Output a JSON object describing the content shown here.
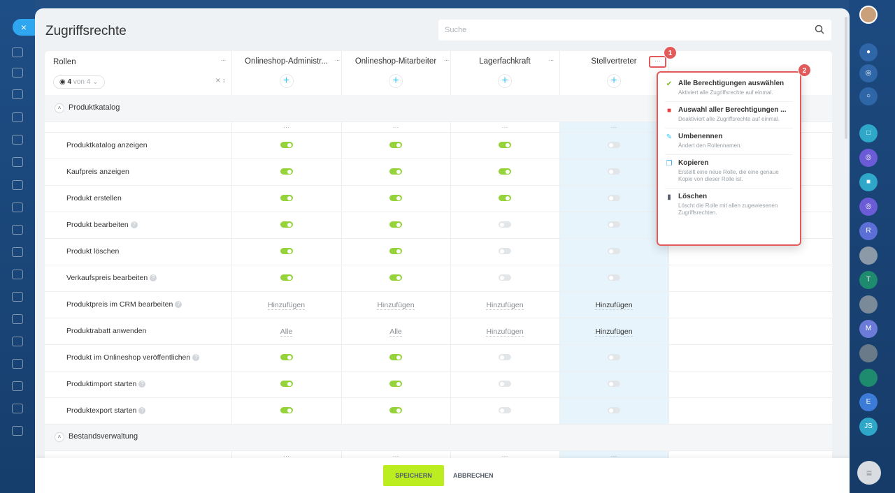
{
  "page": {
    "title": "Zugriffsrechte"
  },
  "search": {
    "placeholder": "Suche"
  },
  "roles_header": {
    "label": "Rollen",
    "filter_count": "4",
    "filter_total": "von 4"
  },
  "roles": [
    {
      "name": "Onlineshop-Administr..."
    },
    {
      "name": "Onlineshop-Mitarbeiter"
    },
    {
      "name": "Lagerfachkraft"
    },
    {
      "name": "Stellvertreter"
    }
  ],
  "sections": [
    {
      "title": "Produktkatalog",
      "rows": [
        {
          "label": "Produktkatalog anzeigen",
          "hint": false,
          "values": [
            "on",
            "on",
            "on",
            "off"
          ]
        },
        {
          "label": "Kaufpreis anzeigen",
          "hint": false,
          "values": [
            "on",
            "on",
            "on",
            "off"
          ]
        },
        {
          "label": "Produkt erstellen",
          "hint": false,
          "values": [
            "on",
            "on",
            "on",
            "off"
          ]
        },
        {
          "label": "Produkt bearbeiten",
          "hint": true,
          "values": [
            "on",
            "on",
            "off",
            "off"
          ]
        },
        {
          "label": "Produkt löschen",
          "hint": false,
          "values": [
            "on",
            "on",
            "off",
            "off"
          ]
        },
        {
          "label": "Verkaufspreis bearbeiten",
          "hint": true,
          "values": [
            "on",
            "on",
            "off",
            "off"
          ]
        },
        {
          "label": "Produktpreis im CRM bearbeiten",
          "hint": true,
          "values": [
            "Hinzufügen",
            "Hinzufügen",
            "Hinzufügen",
            "Hinzufügen"
          ]
        },
        {
          "label": "Produktrabatt anwenden",
          "hint": false,
          "values": [
            "Alle",
            "Alle",
            "Hinzufügen",
            "Hinzufügen"
          ]
        },
        {
          "label": "Produkt im Onlineshop veröffentlichen",
          "hint": true,
          "values": [
            "on",
            "on",
            "off",
            "off"
          ]
        },
        {
          "label": "Produktimport starten",
          "hint": true,
          "values": [
            "on",
            "on",
            "off",
            "off"
          ]
        },
        {
          "label": "Produktexport starten",
          "hint": true,
          "values": [
            "on",
            "on",
            "off",
            "off"
          ]
        }
      ]
    },
    {
      "title": "Bestandsverwaltung",
      "rows": []
    }
  ],
  "menu": {
    "items": [
      {
        "title": "Alle Berechtigungen auswählen",
        "desc": "Aktiviert alle Zugriffsrechte auf einmal.",
        "icon": "check-icon",
        "color": "#7ac120"
      },
      {
        "title": "Auswahl aller Berechtigungen ...",
        "desc": "Deaktiviert alle Zugriffsrechte auf einmal.",
        "icon": "lock-icon",
        "color": "#e53e3e"
      },
      {
        "title": "Umbenennen",
        "desc": "Ändert den Rollennamen.",
        "icon": "pencil-icon",
        "color": "#2fc6f6"
      },
      {
        "title": "Kopieren",
        "desc": "Erstellt eine neue Rolle, die eine genaue Kopie von dieser Rolle ist.",
        "icon": "copy-icon",
        "color": "#2fa6f0"
      },
      {
        "title": "Löschen",
        "desc": "Löscht die Rolle mit allen zugewiesenen Zugriffsrechten.",
        "icon": "trash-icon",
        "color": "#525c69"
      }
    ]
  },
  "badges": {
    "one": "1",
    "two": "2"
  },
  "footer": {
    "save_label": "SPEICHERN",
    "cancel_label": "ABBRECHEN"
  },
  "left_nav": {
    "close_symbol": "×"
  },
  "right_rail": {
    "avatars": [
      {
        "letter": "R",
        "color": "#5b6fd6"
      },
      {
        "letter": "T",
        "color": "#1e8a6e"
      },
      {
        "letter": "M",
        "color": "#6c7bd8"
      },
      {
        "letter": "E",
        "color": "#3d7bd8"
      },
      {
        "letter": "JS",
        "color": "#2ea7c9"
      }
    ]
  },
  "colors": {
    "accent": "#bbed21",
    "toggle_on": "#95d33a",
    "highlight": "#e25a5a",
    "plus": "#2fc6f6"
  }
}
